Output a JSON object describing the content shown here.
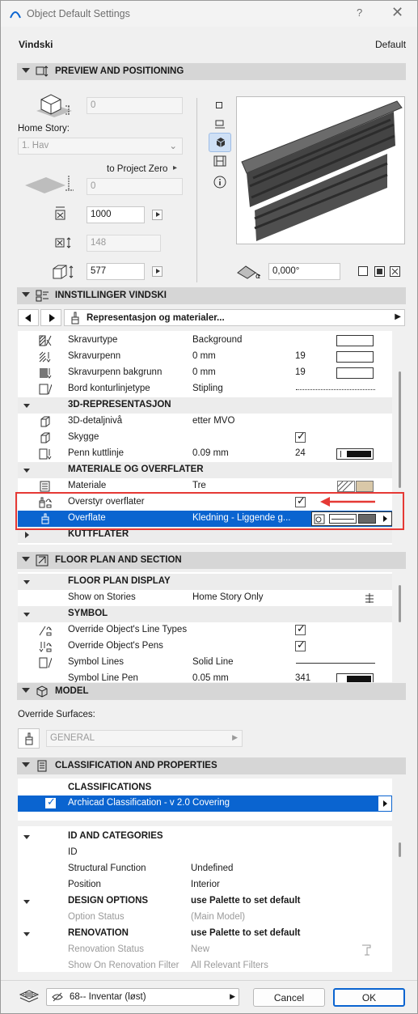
{
  "window": {
    "title": "Object Default Settings",
    "help": "?",
    "close": "✕"
  },
  "header": {
    "object_name": "Vindski",
    "default_label": "Default"
  },
  "preview": {
    "section_title": "PREVIEW AND POSITIONING",
    "elevation_value": "0",
    "home_story_label": "Home Story:",
    "home_story_value": "1. Hav",
    "project_zero_label": "to Project Zero",
    "project_zero_value": "0",
    "width_value": "1000",
    "depth_value": "148",
    "height_value": "577",
    "angle_value": "0,000°"
  },
  "settings": {
    "section_title": "INNSTILLINGER VINDSKI",
    "panel_selector": "Representasjon og materialer...",
    "rows": [
      {
        "label": "Skravurtype",
        "value": "Background",
        "num": ""
      },
      {
        "label": "Skravurpenn",
        "value": "0 mm",
        "num": "19"
      },
      {
        "label": "Skravurpenn bakgrunn",
        "value": "0 mm",
        "num": "19"
      },
      {
        "label": "Bord konturlinjetype",
        "value": "Stipling",
        "num": ""
      },
      {
        "label": "3D-REPRESENTASJON",
        "value": "",
        "num": ""
      },
      {
        "label": "3D-detaljnivå",
        "value": "etter MVO",
        "num": ""
      },
      {
        "label": "Skygge",
        "value": "",
        "num": ""
      },
      {
        "label": "Penn kuttlinje",
        "value": "0.09 mm",
        "num": "24"
      },
      {
        "label": "MATERIALE OG OVERFLATER",
        "value": "",
        "num": ""
      },
      {
        "label": "Materiale",
        "value": "Tre",
        "num": ""
      },
      {
        "label": "Overstyr overflater",
        "value": "",
        "num": ""
      },
      {
        "label": "Overflate",
        "value": "Kledning - Liggende g...",
        "num": ""
      },
      {
        "label": "KUTTFLATER",
        "value": "",
        "num": ""
      }
    ]
  },
  "floorplan": {
    "section_title": "FLOOR PLAN AND SECTION",
    "rows": [
      {
        "label": "FLOOR PLAN DISPLAY",
        "value": "",
        "num": ""
      },
      {
        "label": "Show on Stories",
        "value": "Home Story Only",
        "num": ""
      },
      {
        "label": "SYMBOL",
        "value": "",
        "num": ""
      },
      {
        "label": "Override Object's Line Types",
        "value": "",
        "num": ""
      },
      {
        "label": "Override Object's Pens",
        "value": "",
        "num": ""
      },
      {
        "label": "Symbol Lines",
        "value": "Solid Line",
        "num": ""
      },
      {
        "label": "Symbol Line Pen",
        "value": "0.05 mm",
        "num": "341"
      }
    ]
  },
  "model": {
    "section_title": "MODEL",
    "override_label": "Override Surfaces:",
    "general_value": "GENERAL"
  },
  "classification": {
    "section_title": "CLASSIFICATION AND PROPERTIES",
    "classifications_label": "CLASSIFICATIONS",
    "classification_value": "Archicad Classification - v 2.0 Covering",
    "rows": [
      {
        "label": "ID AND CATEGORIES",
        "value": ""
      },
      {
        "label": "ID",
        "value": ""
      },
      {
        "label": "Structural Function",
        "value": "Undefined"
      },
      {
        "label": "Position",
        "value": "Interior"
      },
      {
        "label": "DESIGN OPTIONS",
        "value": "use Palette to set default"
      },
      {
        "label": "Option Status",
        "value": "(Main Model)"
      },
      {
        "label": "RENOVATION",
        "value": "use Palette to set default"
      },
      {
        "label": "Renovation Status",
        "value": "New"
      },
      {
        "label": "Show On Renovation Filter",
        "value": "All Relevant Filters"
      }
    ]
  },
  "footer": {
    "layer_value": "68-- Inventar (løst)",
    "cancel_label": "Cancel",
    "ok_label": "OK"
  },
  "colors": {
    "accent": "#0a64d0",
    "highlight": "#e53935"
  }
}
